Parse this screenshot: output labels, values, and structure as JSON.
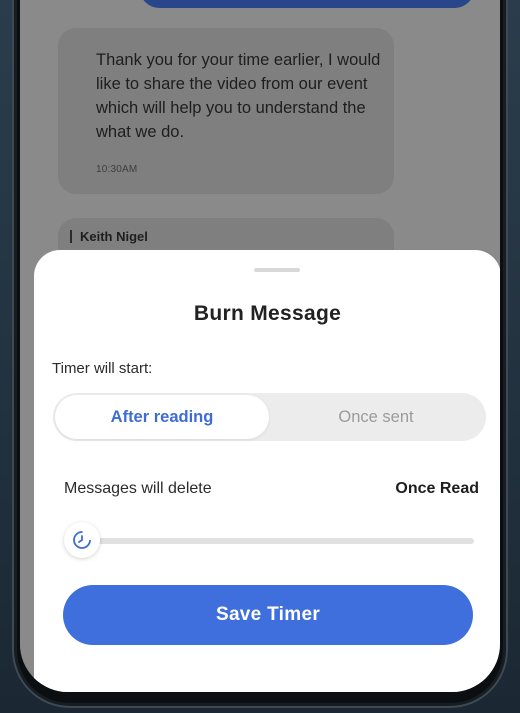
{
  "chat": {
    "message_text": "Thank you for your time earlier, I would like to share the video from our event which will help you to understand the what we do.",
    "message_time": "10:30AM",
    "next_sender": "Keith Nigel"
  },
  "sheet": {
    "title": "Burn Message",
    "timer_label": "Timer will start:",
    "options": [
      {
        "label": "After reading",
        "selected": true
      },
      {
        "label": "Once sent",
        "selected": false
      }
    ],
    "delete_label": "Messages will delete",
    "delete_value": "Once Read",
    "slider_level": 0,
    "save_label": "Save Timer"
  },
  "colors": {
    "accent": "#3f6fdc",
    "selected_text": "#3e6cd6",
    "overlay": "#8a8a8a"
  }
}
